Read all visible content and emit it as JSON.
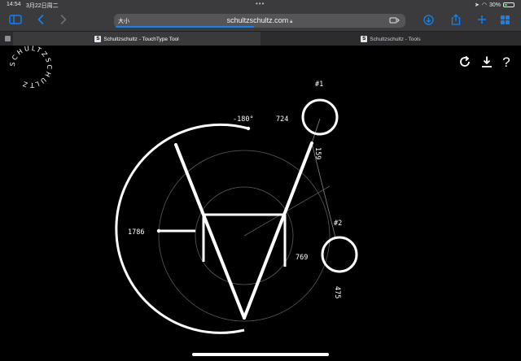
{
  "status_bar": {
    "time": "14:54",
    "date": "3月22日周二",
    "battery": "30%"
  },
  "toolbar": {
    "sidebar_icon": "sidebar-icon",
    "back_icon": "back-icon",
    "forward_icon": "forward-icon",
    "address_left": "大小",
    "url": "schultzschultz.com",
    "lock_icon": "lock-icon",
    "download_icon": "download-icon",
    "share_icon": "share-icon",
    "new_tab_icon": "plus-icon",
    "tabs_icon": "tabs-overview-icon"
  },
  "tabs": [
    {
      "label": "Schultzschultz - TouchType Tool",
      "active": true
    },
    {
      "label": "Schultzschultz - Tools",
      "active": false
    }
  ],
  "page": {
    "logo_text": "SCHULTZSCHULTZ",
    "tools": {
      "reload_icon": "reload-icon",
      "download_icon": "download-icon",
      "help_label": "?"
    },
    "labels": {
      "handle1": "#1",
      "handle2": "#2",
      "angle": "-180°",
      "v724": "724",
      "v159": "159",
      "v1786": "1786",
      "v769": "769",
      "v475": "475"
    }
  }
}
